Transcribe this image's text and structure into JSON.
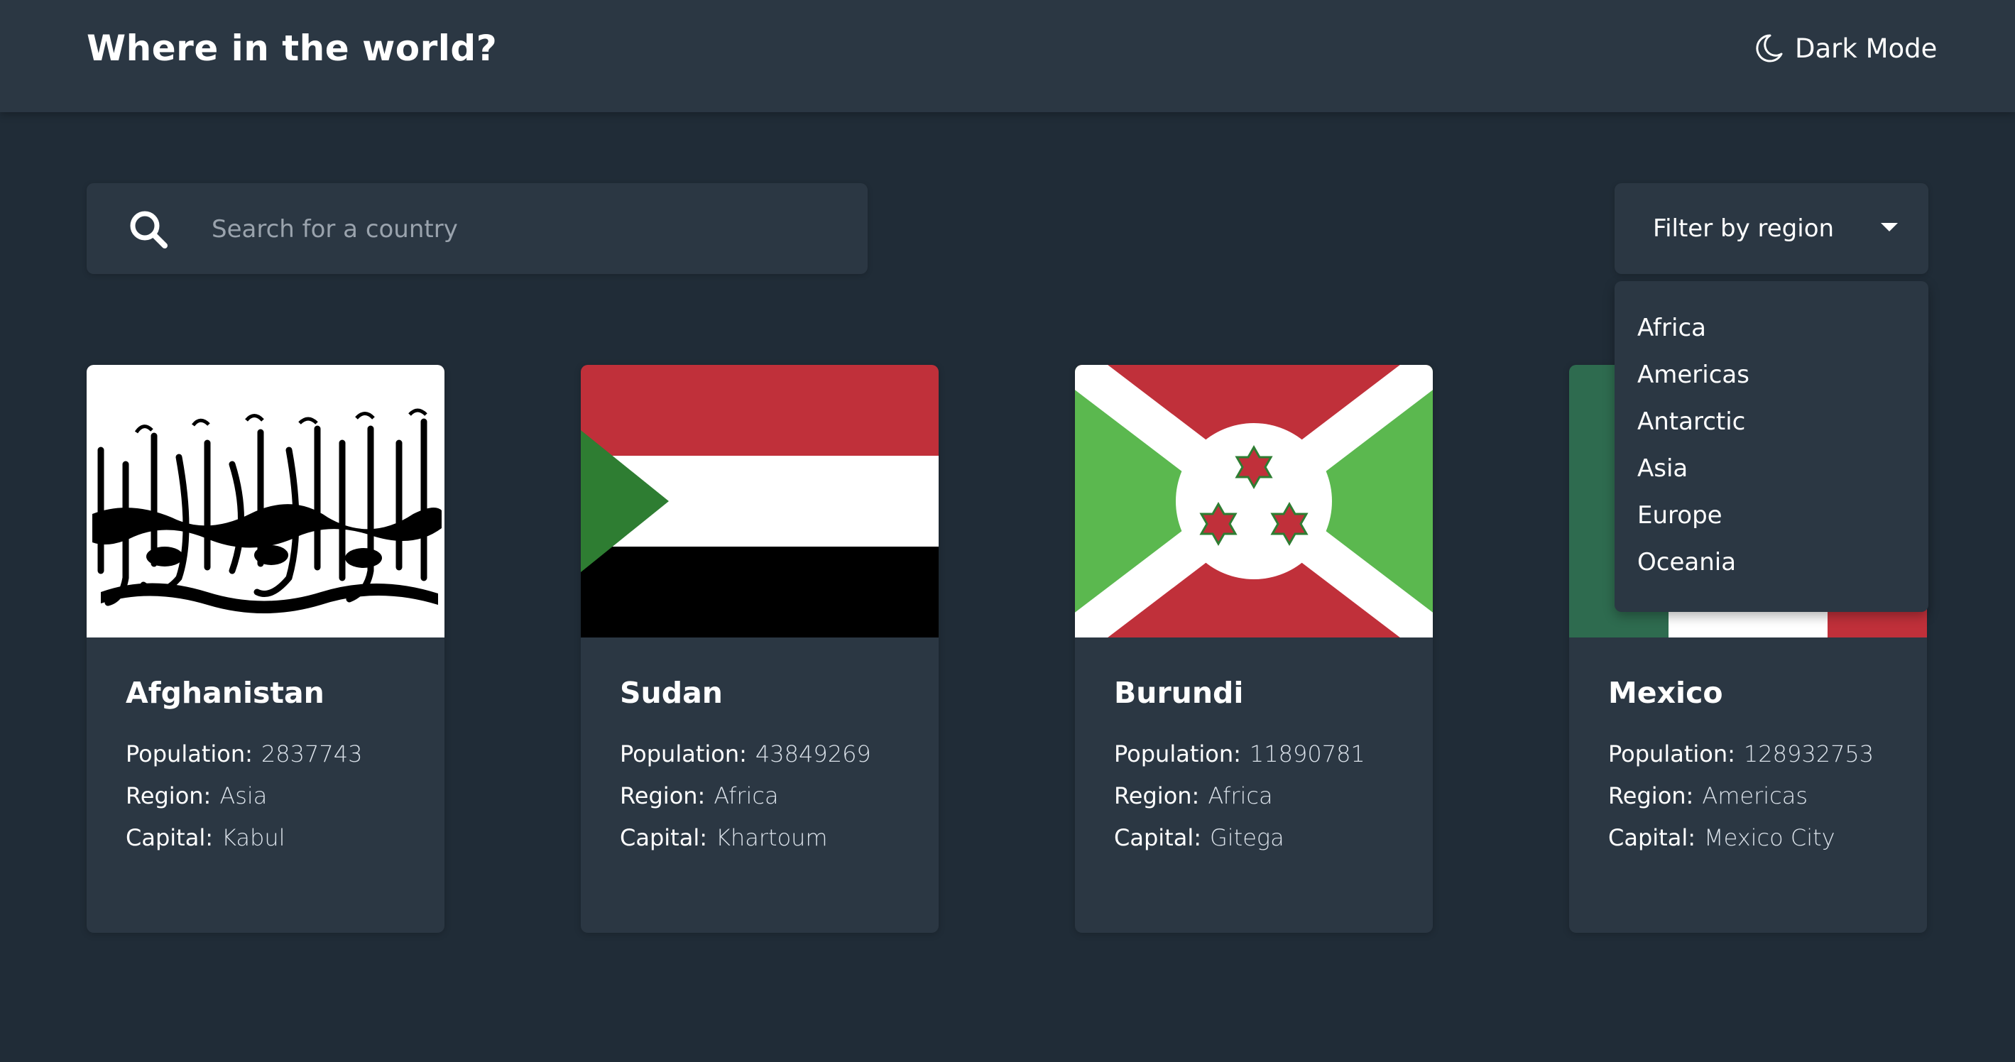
{
  "header": {
    "title": "Where in the world?",
    "theme_toggle_label": "Dark Mode",
    "theme_icon": "moon-icon"
  },
  "search": {
    "placeholder": "Search for a country",
    "value": "",
    "icon": "search-icon"
  },
  "filter": {
    "label": "Filter by region",
    "icon": "caret-down-icon",
    "options": [
      "Africa",
      "Americas",
      "Antarctic",
      "Asia",
      "Europe",
      "Oceania"
    ]
  },
  "labels": {
    "population": "Population:",
    "region": "Region:",
    "capital": "Capital:"
  },
  "countries": [
    {
      "name": "Afghanistan",
      "population": "2837743",
      "region": "Asia",
      "capital": "Kabul"
    },
    {
      "name": "Sudan",
      "population": "43849269",
      "region": "Africa",
      "capital": "Khartoum"
    },
    {
      "name": "Burundi",
      "population": "11890781",
      "region": "Africa",
      "capital": "Gitega"
    },
    {
      "name": "Mexico",
      "population": "128932753",
      "region": "Americas",
      "capital": "Mexico City"
    }
  ],
  "colors": {
    "background": "#202c37",
    "elements": "#2b3743",
    "text": "#ffffff",
    "muted_text": "#9aa3ad"
  }
}
